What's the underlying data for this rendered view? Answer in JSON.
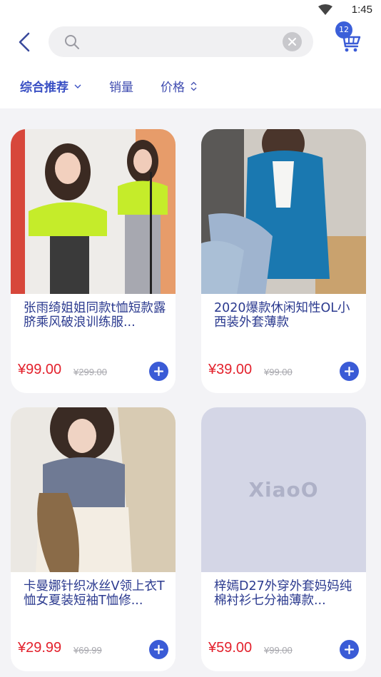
{
  "status": {
    "time": "1:45"
  },
  "header": {
    "search_value": "",
    "cart_count": "12"
  },
  "sort": [
    {
      "label": "综合推荐",
      "active": true,
      "icon": "chevron-down-icon"
    },
    {
      "label": "销量",
      "active": false,
      "icon": ""
    },
    {
      "label": "价格",
      "active": false,
      "icon": "sort-updown-icon"
    }
  ],
  "products": [
    {
      "title": "张雨绮姐姐同款t恤短款露脐乘风破浪训练服...",
      "price": "¥99.00",
      "old_price": "¥299.00",
      "image": "photo-two-women-neon-green-tops"
    },
    {
      "title": "2020爆款休闲知性OL小西装外套薄款",
      "price": "¥39.00",
      "old_price": "¥99.00",
      "image": "photo-woman-blue-blazer-jeans"
    },
    {
      "title": "卡曼娜针织冰丝V领上衣T恤女夏装短袖T恤修...",
      "price": "¥29.99",
      "old_price": "¥69.99",
      "image": "photo-woman-grey-knit-top"
    },
    {
      "title": "梓嫣D27外穿外套妈妈纯棉衬衫七分袖薄款...",
      "price": "¥59.00",
      "old_price": "¥99.00",
      "image": "placeholder",
      "placeholder_text": "XiaoO"
    }
  ],
  "colors": {
    "accent": "#3a5bd6",
    "price": "#e3212c",
    "title": "#2b3a8f"
  }
}
